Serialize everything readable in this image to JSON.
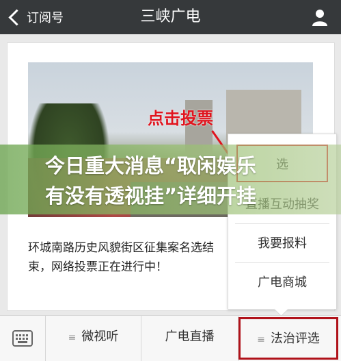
{
  "nav": {
    "back_label": "订阅号",
    "title": "三峡广电",
    "back_icon": "chevron-left-icon",
    "profile_icon": "person-icon"
  },
  "article": {
    "photo_label": "点击投票",
    "caption": "环城南路历史风貌街区征集案名选结束，网络投票正在进行中！"
  },
  "banner": {
    "line1": "今日重大消息“取闲娱乐",
    "line2": "有没有透视挂”详细开挂"
  },
  "popup_menu": {
    "items": [
      "选",
      "直播互动抽奖",
      "我要报料",
      "广电商城"
    ]
  },
  "tabbar": {
    "keyboard_icon": "keyboard-icon",
    "tabs": [
      "微视听",
      "广电直播",
      "法治评选"
    ]
  },
  "colors": {
    "nav_bg": "#36393b",
    "highlight_red": "#e0141e",
    "banner_green": "#6ca550"
  }
}
